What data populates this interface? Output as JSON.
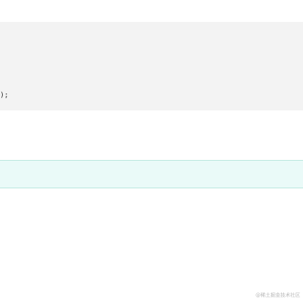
{
  "code_block": {
    "visible_line": ");"
  },
  "notice_bar": {
    "text": ""
  },
  "watermark": {
    "text": "@稀土掘金技术社区"
  }
}
